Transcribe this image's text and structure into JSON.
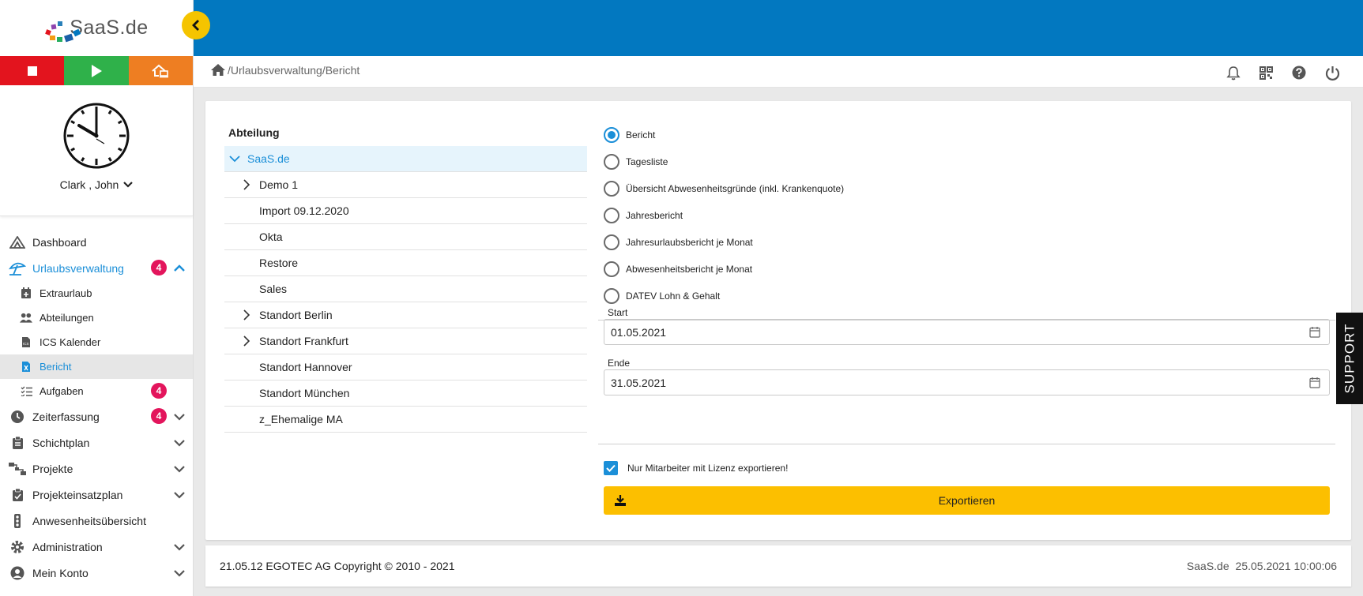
{
  "brand": {
    "name": "SaaS.de",
    "accent": "#0278c0",
    "link_color": "#1b8fd8"
  },
  "actionbar": {
    "stop_icon": "stop-icon",
    "play_icon": "play-icon",
    "home_office_icon": "home-office-icon"
  },
  "user": {
    "name": "Clark , John"
  },
  "nav": {
    "dashboard": "Dashboard",
    "urlaub": "Urlaubsverwaltung",
    "urlaub_badge": "4",
    "extraurlaub": "Extraurlaub",
    "abteilungen": "Abteilungen",
    "ics": "ICS Kalender",
    "bericht": "Bericht",
    "aufgaben": "Aufgaben",
    "aufgaben_badge": "4",
    "zeiterfassung": "Zeiterfassung",
    "zeit_badge": "4",
    "schichtplan": "Schichtplan",
    "projekte": "Projekte",
    "projekteinsatzplan": "Projekteinsatzplan",
    "anwesenheit": "Anwesenheitsübersicht",
    "administration": "Administration",
    "konto": "Mein Konto"
  },
  "breadcrumb": "/Urlaubsverwaltung/Bericht",
  "department": {
    "title": "Abteilung",
    "root": "SaaS.de",
    "items": [
      "Demo 1",
      "Import 09.12.2020",
      "Okta",
      "Restore",
      "Sales",
      "Standort Berlin",
      "Standort Frankfurt",
      "Standort Hannover",
      "Standort München",
      "z_Ehemalige MA"
    ]
  },
  "report_types": {
    "selected": "Bericht",
    "options": [
      "Bericht",
      "Tagesliste",
      "Übersicht Abwesenheitsgründe (inkl. Krankenquote)",
      "Jahresbericht",
      "Jahresurlaubsbericht je Monat",
      "Abwesenheitsbericht je Monat",
      "DATEV Lohn & Gehalt"
    ]
  },
  "dates": {
    "start_label": "Start",
    "start_value": "01.05.2021",
    "end_label": "Ende",
    "end_value": "31.05.2021"
  },
  "license_checkbox": {
    "label": "Nur Mitarbeiter mit Lizenz exportieren!",
    "checked": true
  },
  "export_button": "Exportieren",
  "footer": {
    "left": "21.05.12 EGOTEC AG Copyright © 2010 - 2021",
    "brand": "SaaS.de",
    "timestamp": "25.05.2021 10:00:06"
  },
  "support": "SUPPORT"
}
